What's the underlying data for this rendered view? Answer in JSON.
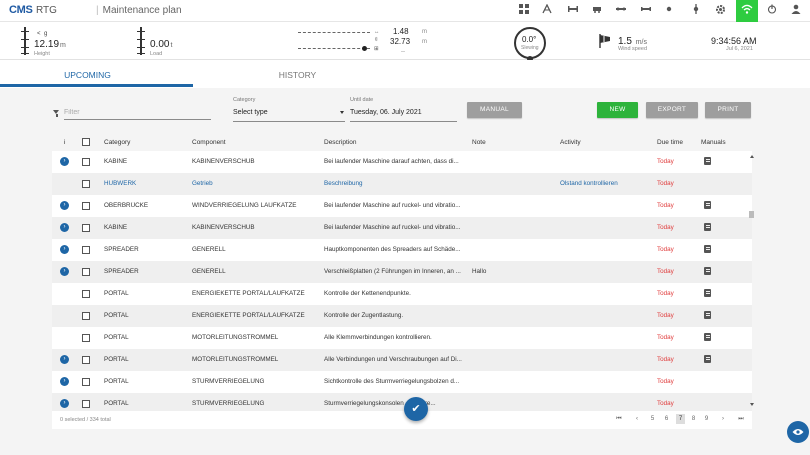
{
  "header": {
    "brand": "CMS",
    "brand_sub": "RTG",
    "title": "Maintenance plan",
    "toolbar_icons": [
      "dashboard-icon",
      "crane-icon",
      "spreader-icon",
      "trolley-icon",
      "gantry-icon",
      "hoist-icon",
      "slewing-icon",
      "settings-icon",
      "wifi-icon",
      "power-icon",
      "user-icon"
    ]
  },
  "status": {
    "height_value": "12.19",
    "height_unit": "m",
    "height_label": "Height",
    "height_arrow_left": "<",
    "height_arrow_right": "g",
    "load_value": "0.00",
    "load_unit": "t",
    "load_label": "Load",
    "trolley_top_value": "1.48",
    "trolley_top_unit": "m",
    "trolley_mid_value": "32.73",
    "trolley_mid_unit": "m",
    "trolley_bottom_value": "--",
    "slewing_value": "0.0°",
    "slewing_label": "Slewing",
    "wind_value": "1.5",
    "wind_unit": "m/s",
    "wind_label": "Wind speed",
    "time": "9:34:56 AM",
    "date": "Jul 6, 2021"
  },
  "tabs": [
    {
      "label": "UPCOMING",
      "active": true
    },
    {
      "label": "HISTORY",
      "active": false
    }
  ],
  "filters": {
    "filter_placeholder": "Filter",
    "category_label": "Category",
    "category_value": "Select type",
    "until_label": "Until date",
    "until_value": "Tuesday, 06. July 2021"
  },
  "buttons": {
    "manual": "MANUAL",
    "new": "NEW",
    "export": "EXPORT",
    "print": "PRINT"
  },
  "table": {
    "columns": {
      "info": "i",
      "category": "Category",
      "component": "Component",
      "description": "Description",
      "note": "Note",
      "activity": "Activity",
      "due_time": "Due time",
      "manuals": "Manuals"
    },
    "rows": [
      {
        "expand": true,
        "category": "KABINE",
        "component": "KABINENVERSCHUB",
        "description": "Bei laufender Maschine darauf achten, dass di...",
        "note": "",
        "activity": "",
        "due": "Today",
        "manual": true,
        "link": false
      },
      {
        "expand": false,
        "category": "HUBWERK",
        "component": "Getrieb",
        "description": "Beschreibung",
        "note": "",
        "activity": "Ölstand kontrollieren",
        "due": "Today",
        "manual": false,
        "link": true
      },
      {
        "expand": true,
        "category": "OBERBRÜCKE",
        "component": "WINDVERRIEGELUNG LAUFKATZE",
        "description": "Bei laufender Maschine auf ruckel- und vibratio...",
        "note": "",
        "activity": "",
        "due": "Today",
        "manual": true,
        "link": false
      },
      {
        "expand": true,
        "category": "KABINE",
        "component": "KABINENVERSCHUB",
        "description": "Bei laufender Maschine auf ruckel- und vibratio...",
        "note": "",
        "activity": "",
        "due": "Today",
        "manual": true,
        "link": false
      },
      {
        "expand": true,
        "category": "SPREADER",
        "component": "GENERELL",
        "description": "Hauptkomponenten des Spreaders auf Schäde...",
        "note": "",
        "activity": "",
        "due": "Today",
        "manual": true,
        "link": false
      },
      {
        "expand": true,
        "category": "SPREADER",
        "component": "GENERELL",
        "description": "Verschleißplatten (2 Führungen im Inneren, an ...",
        "note": "Hallo",
        "activity": "",
        "due": "Today",
        "manual": true,
        "link": false
      },
      {
        "expand": false,
        "category": "PORTAL",
        "component": "ENERGIEKETTE PORTAL/LAUFKATZE",
        "description": "Kontrolle der Kettenendpunkte.",
        "note": "",
        "activity": "",
        "due": "Today",
        "manual": true,
        "link": false
      },
      {
        "expand": false,
        "category": "PORTAL",
        "component": "ENERGIEKETTE PORTAL/LAUFKATZE",
        "description": "Kontrolle der Zugentlastung.",
        "note": "",
        "activity": "",
        "due": "Today",
        "manual": true,
        "link": false
      },
      {
        "expand": false,
        "category": "PORTAL",
        "component": "MOTORLEITUNGSTROMMEL",
        "description": "Alle Klemmverbindungen kontrollieren.",
        "note": "",
        "activity": "",
        "due": "Today",
        "manual": true,
        "link": false
      },
      {
        "expand": true,
        "category": "PORTAL",
        "component": "MOTORLEITUNGSTROMMEL",
        "description": "Alle Verbindungen und Verschraubungen auf Di...",
        "note": "",
        "activity": "",
        "due": "Today",
        "manual": true,
        "link": false
      },
      {
        "expand": true,
        "category": "PORTAL",
        "component": "STURMVERRIEGELUNG",
        "description": "Sichtkontrolle des Sturmverriegelungsbolzen d...",
        "note": "",
        "activity": "",
        "due": "Today",
        "manual": false,
        "link": false
      },
      {
        "expand": true,
        "category": "PORTAL",
        "component": "STURMVERRIEGELUNG",
        "description": "Sturmverriegelungskonsolen ... und re...",
        "note": "",
        "activity": "",
        "due": "Today",
        "manual": false,
        "link": false
      }
    ]
  },
  "footer": {
    "selected_info": "0 selected / 334 total",
    "pages": [
      "5",
      "6",
      "7",
      "8",
      "9"
    ],
    "current_page": "7",
    "first": "⏮",
    "prev": "‹",
    "next": "›",
    "last": "⏭"
  },
  "colors": {
    "accent": "#1e66a6",
    "new_button": "#2db33b",
    "due_today": "#e03c3c",
    "wifi_active": "#2ecc40"
  }
}
